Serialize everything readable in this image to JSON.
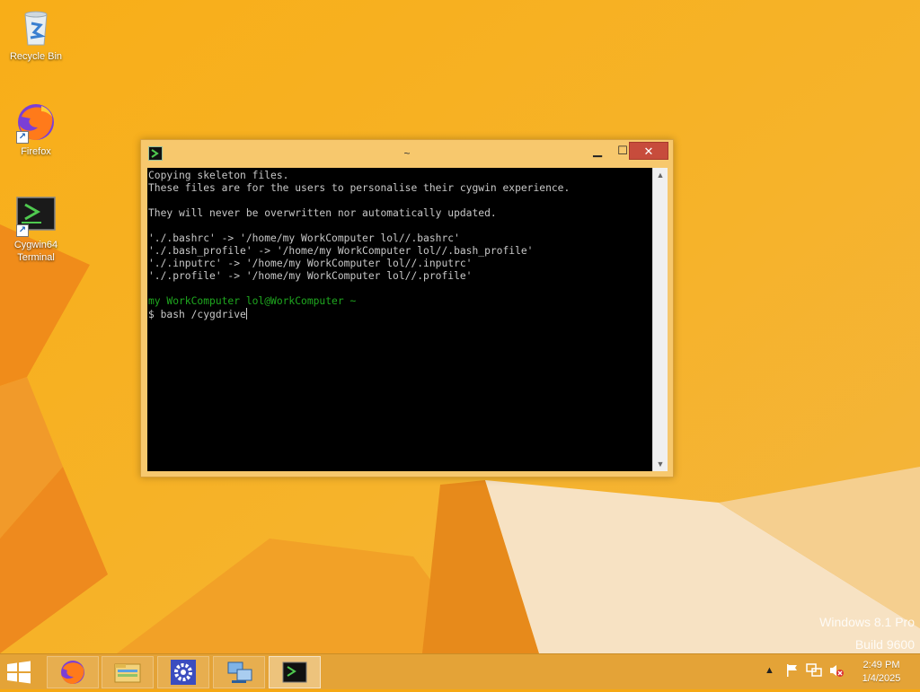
{
  "desktop": {
    "icons": [
      {
        "label": "Recycle Bin"
      },
      {
        "label": "Firefox"
      },
      {
        "label": "Cygwin64\nTerminal"
      }
    ],
    "watermark_line1": "Windows 8.1 Pro",
    "watermark_line2": "Build 9600"
  },
  "terminal": {
    "title": "~",
    "lines": [
      "Copying skeleton files.",
      "These files are for the users to personalise their cygwin experience.",
      "",
      "They will never be overwritten nor automatically updated.",
      "",
      "'./.bashrc' -> '/home/my WorkComputer lol//.bashrc'",
      "'./.bash_profile' -> '/home/my WorkComputer lol//.bash_profile'",
      "'./.inputrc' -> '/home/my WorkComputer lol//.inputrc'",
      "'./.profile' -> '/home/my WorkComputer lol//.profile'",
      ""
    ],
    "prompt_user": "my WorkComputer lol@WorkComputer",
    "prompt_dir": "~",
    "command": "$ bash /cygdrive"
  },
  "taskbar": {
    "apps": [
      "firefox-icon",
      "file-explorer-icon",
      "settings-icon",
      "network-icon",
      "cygwin-terminal-icon"
    ],
    "time": "2:49 PM",
    "date": "1/4/2025"
  },
  "colors": {
    "wallpaper": "#f6a913",
    "window_frame": "#f7c86d",
    "close_button": "#c74c3c",
    "prompt_green": "#1fa81f"
  }
}
